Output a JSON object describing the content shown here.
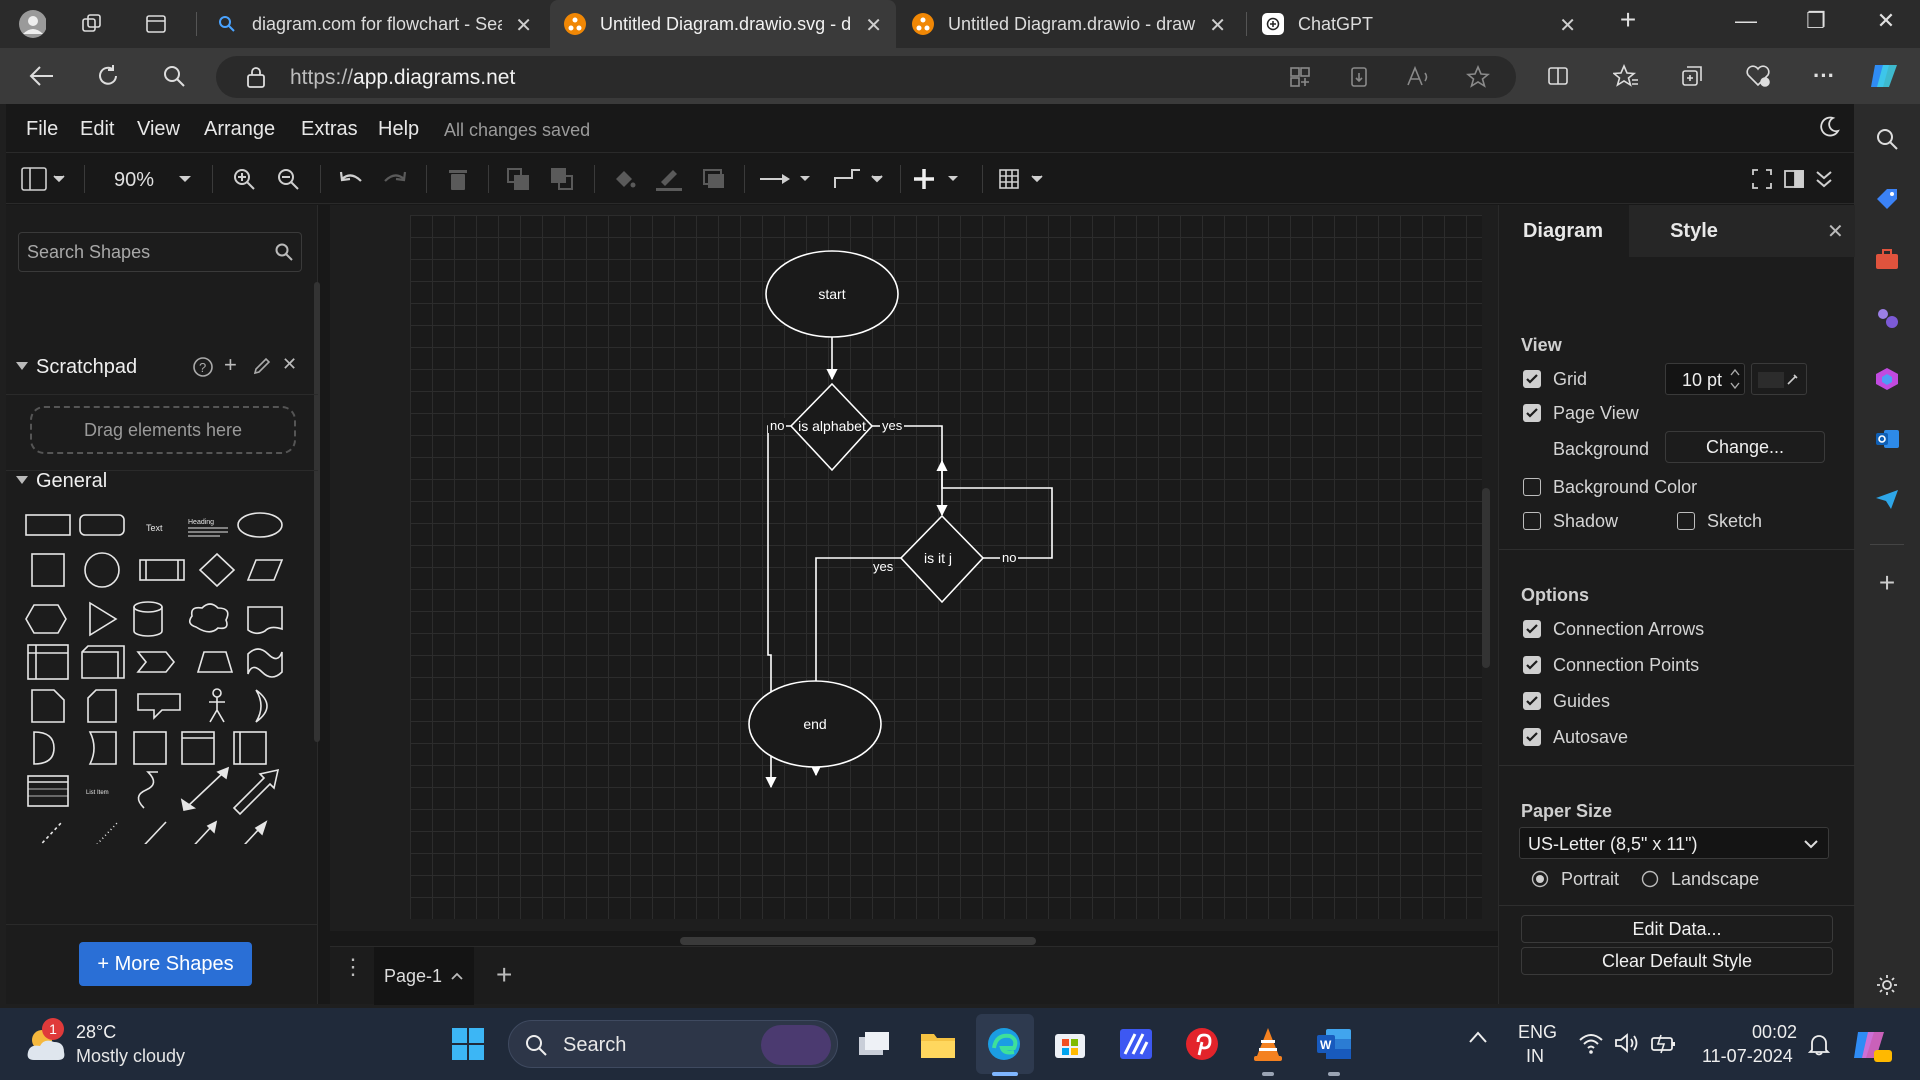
{
  "browser": {
    "tabs": [
      {
        "title": "diagram.com for flowchart - Sea",
        "icon": "bing-search-icon"
      },
      {
        "title": "Untitled Diagram.drawio.svg - d",
        "icon": "drawio-icon",
        "active": true
      },
      {
        "title": "Untitled Diagram.drawio - draw",
        "icon": "drawio-icon"
      },
      {
        "title": "ChatGPT",
        "icon": "chatgpt-icon"
      }
    ],
    "url_prefix": "https://",
    "url_host": "app.diagrams.net"
  },
  "app": {
    "menu": [
      "File",
      "Edit",
      "View",
      "Arrange",
      "Extras",
      "Help"
    ],
    "save_status": "All changes saved",
    "zoom": "90%"
  },
  "left_panel": {
    "search_placeholder": "Search Shapes",
    "scratchpad_title": "Scratchpad",
    "dropzone_text": "Drag elements here",
    "general_title": "General",
    "shape_labels": {
      "text": "Text",
      "heading": "Heading",
      "list_item": "List Item"
    },
    "more_shapes_label": "+ More Shapes"
  },
  "diagram": {
    "nodes": {
      "start": "start",
      "decision1": "is alphabet",
      "decision2": "is it j",
      "end": "end"
    },
    "edge_labels": {
      "d1_no": "no",
      "d1_yes": "yes",
      "d2_yes": "yes",
      "d2_no": "no"
    }
  },
  "page_tabs": {
    "current": "Page-1"
  },
  "right_panel": {
    "tabs": [
      "Diagram",
      "Style"
    ],
    "view_title": "View",
    "grid_label": "Grid",
    "grid_size": "10 pt",
    "page_view_label": "Page View",
    "background_label": "Background",
    "change_button": "Change...",
    "background_color_label": "Background Color",
    "shadow_label": "Shadow",
    "sketch_label": "Sketch",
    "options_title": "Options",
    "options": [
      "Connection Arrows",
      "Connection Points",
      "Guides",
      "Autosave"
    ],
    "paper_size_title": "Paper Size",
    "paper_size": "US-Letter (8,5\" x 11\")",
    "portrait_label": "Portrait",
    "landscape_label": "Landscape",
    "edit_data_button": "Edit Data...",
    "clear_style_button": "Clear Default Style"
  },
  "taskbar": {
    "weather_temp": "28°C",
    "weather_desc": "Mostly cloudy",
    "weather_badge": "1",
    "search_label": "Search",
    "lang_primary": "ENG",
    "lang_secondary": "IN",
    "time": "00:02",
    "date": "11-07-2024"
  },
  "colors": {
    "accent_blue": "#2a6fd6",
    "canvas_bg": "#1a1a1a",
    "drawio_orange": "#f08705"
  }
}
